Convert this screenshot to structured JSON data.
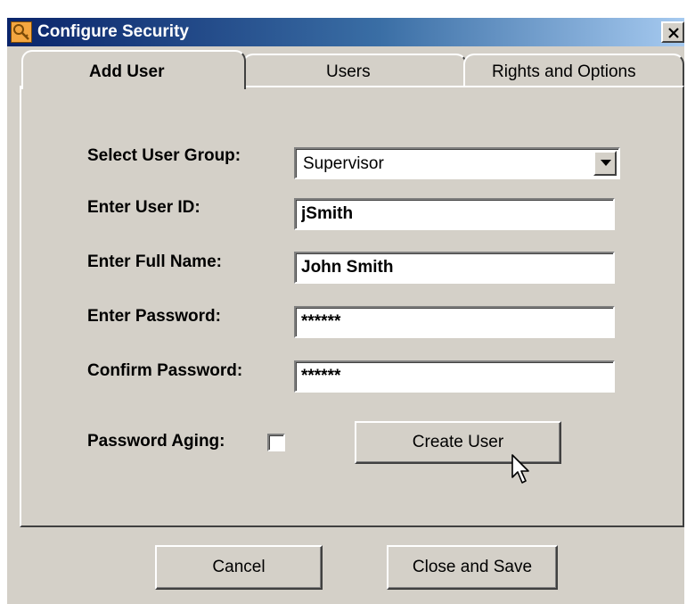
{
  "window": {
    "title": "Configure Security",
    "close_symbol": "×",
    "title_icon": "lock-key-icon"
  },
  "tabs": [
    {
      "label": "Add User",
      "active": true
    },
    {
      "label": "Users",
      "active": false
    },
    {
      "label": "Rights and Options",
      "active": false
    }
  ],
  "form": {
    "user_group": {
      "label": "Select User Group:",
      "value": "Supervisor"
    },
    "user_id": {
      "label": "Enter User ID:",
      "value": "jSmith"
    },
    "full_name": {
      "label": "Enter Full Name:",
      "value": "John Smith"
    },
    "password": {
      "label": "Enter Password:",
      "value": "******"
    },
    "confirm_password": {
      "label": "Confirm Password:",
      "value": "******"
    },
    "password_aging": {
      "label": "Password Aging:",
      "checked": false
    },
    "create_button": "Create User"
  },
  "footer": {
    "cancel_button": "Cancel",
    "close_save_button": "Close and Save"
  },
  "colors": {
    "face": "#d4d0c8",
    "titlebar_start": "#0a246a",
    "titlebar_end": "#a6caf0"
  }
}
